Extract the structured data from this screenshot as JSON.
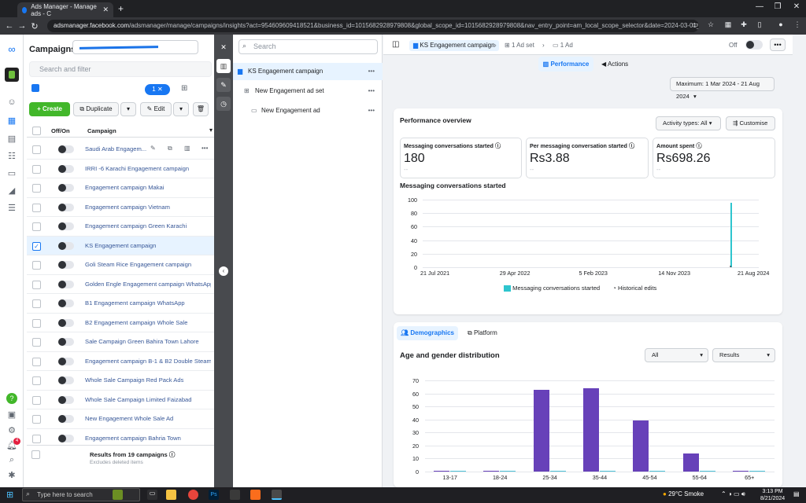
{
  "browser": {
    "tab_title": "Ads Manager - Manage ads - C",
    "url_host": "adsmanager.facebook.com",
    "url_rest": "/adsmanager/manage/campaigns/insights?act=954609609418521&business_id=1015682928979808&global_scope_id=1015682928979808&nav_entry_point=am_local_scope_selector&date=2024-03-01_2024-08-..."
  },
  "campaigns_panel": {
    "title": "Campaigns",
    "search_placeholder": "Search and filter",
    "filter_count": "1",
    "create_label": "Create",
    "duplicate_label": "Duplicate",
    "edit_label": "Edit",
    "col_offon": "Off/On",
    "col_campaign": "Campaign",
    "rows": [
      {
        "name": "Saudi Arab Engagem..."
      },
      {
        "name": "IRRI -6 Karachi Engagement campaign"
      },
      {
        "name": "Engagement campaign Makai"
      },
      {
        "name": "Engagement campaign Vietnam"
      },
      {
        "name": "Engagement campaign Green Karachi"
      },
      {
        "name": "KS Engagement campaign"
      },
      {
        "name": "Goli Steam Rice Engagement campaign"
      },
      {
        "name": "Golden Engle Engagement campaign WhatsApp"
      },
      {
        "name": "B1 Engagement campaign WhatsApp"
      },
      {
        "name": "B2 Engagement campaign Whole Sale"
      },
      {
        "name": "Sale Campaign Green Bahira Town Lahore"
      },
      {
        "name": "Engagement campaign B-1 & B2 Double Steam R..."
      },
      {
        "name": "Whole Sale Campaign Red Pack Ads"
      },
      {
        "name": "Whole Sale Campaign Limited Faizabad"
      },
      {
        "name": "New Engagement Whole Sale Ad"
      },
      {
        "name": "Engagement campaign Bahria Town"
      }
    ],
    "results_label": "Results from 19 campaigns",
    "excludes_label": "Excludes deleted items"
  },
  "tree": {
    "search_placeholder": "Search",
    "items": [
      {
        "label": "KS Engagement campaign"
      },
      {
        "label": "New Engagement ad set"
      },
      {
        "label": "New Engagement ad"
      }
    ]
  },
  "header": {
    "breadcrumb_campaign": "KS Engagement campaign",
    "breadcrumb_adset": "1 Ad set",
    "breadcrumb_ad": "1 Ad",
    "off_label": "Off",
    "tab_performance": "Performance",
    "tab_actions": "Actions",
    "date_range": "Maximum: 1 Mar 2024 - 21 Aug 2024"
  },
  "overview": {
    "title": "Performance overview",
    "activity_label": "Activity types: All",
    "customise_label": "Customise",
    "metrics": [
      {
        "label": "Messaging conversations started",
        "value": "180",
        "sub": "--"
      },
      {
        "label": "Per messaging conversation started",
        "value": "Rs3.88",
        "sub": "--"
      },
      {
        "label": "Amount spent",
        "value": "Rs698.26",
        "sub": "--"
      }
    ],
    "chart_title": "Messaging conversations started",
    "legend_series": "Messaging conversations started",
    "legend_hist": "Historical edits"
  },
  "demographics": {
    "tab_demo": "Demographics",
    "tab_platform": "Platform",
    "title": "Age and gender distribution",
    "dd_all": "All",
    "dd_results": "Results"
  },
  "chart_data": [
    {
      "type": "line",
      "title": "Messaging conversations started",
      "x_ticks": [
        "21 Jul 2021",
        "29 Apr 2022",
        "5 Feb 2023",
        "14 Nov 2023",
        "21 Aug 2024"
      ],
      "y_ticks": [
        0,
        20,
        40,
        60,
        80,
        100
      ],
      "ylim": [
        0,
        100
      ],
      "series": [
        {
          "name": "Messaging conversations started",
          "color": "#2ec5ce",
          "spike_date": "2024-03",
          "spike_value": 95
        }
      ],
      "grid": true
    },
    {
      "type": "bar",
      "title": "Age and gender distribution",
      "categories": [
        "13-17",
        "18-24",
        "25-34",
        "35-44",
        "45-54",
        "55-64",
        "65+"
      ],
      "series": [
        {
          "color": "#6741b9",
          "values": [
            0,
            0,
            63,
            64,
            39,
            14,
            0
          ]
        },
        {
          "color": "#4dc3d7",
          "values": [
            0,
            0,
            0,
            0,
            0,
            0,
            0
          ]
        }
      ],
      "y_ticks": [
        0,
        10,
        20,
        30,
        40,
        50,
        60,
        70
      ],
      "ylim": [
        0,
        70
      ],
      "grid": true
    }
  ],
  "taskbar": {
    "search_placeholder": "Type here to search",
    "weather": "29°C  Smoke",
    "time": "3:13 PM",
    "date": "8/21/2024"
  }
}
